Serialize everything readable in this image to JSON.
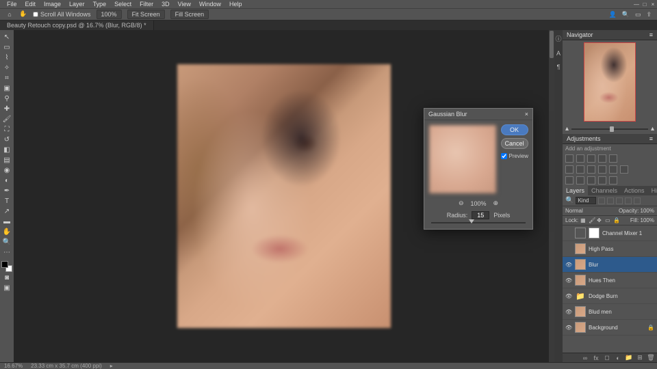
{
  "menu": [
    "File",
    "Edit",
    "Image",
    "Layer",
    "Type",
    "Select",
    "Filter",
    "3D",
    "View",
    "Window",
    "Help"
  ],
  "win": {
    "min": "—",
    "max": "□",
    "close": "×"
  },
  "options": {
    "scroll_all": "Scroll All Windows",
    "zoom_100": "100%",
    "fit_screen": "Fit Screen",
    "fill_screen": "Fill Screen"
  },
  "doc_tab": "Beauty Retouch copy.psd @ 16.7% (Blur, RGB/8) *",
  "status": {
    "zoom": "16.67%",
    "dim": "23.33 cm x 35.7 cm (400 ppi)"
  },
  "dialog": {
    "title": "Gaussian Blur",
    "ok": "OK",
    "cancel": "Cancel",
    "preview": "Preview",
    "zoom_out": "⊖",
    "zoom_pct": "100%",
    "zoom_in": "⊕",
    "radius_label": "Radius:",
    "radius_value": "15",
    "radius_unit": "Pixels"
  },
  "navigator": {
    "title": "Navigator"
  },
  "adjustments": {
    "title": "Adjustments",
    "hint": "Add an adjustment"
  },
  "layers": {
    "tabs": [
      "Layers",
      "Channels",
      "Actions",
      "History"
    ],
    "filter_kind": "Kind",
    "blend": "Normal",
    "opacity_label": "Opacity:",
    "opacity": "100%",
    "lock_label": "Lock:",
    "fill_label": "Fill:",
    "fill": "100%",
    "items": [
      {
        "visible": false,
        "name": "Channel Mixer 1",
        "type": "adj"
      },
      {
        "visible": false,
        "name": "High Pass",
        "type": "img"
      },
      {
        "visible": true,
        "name": "Blur",
        "type": "img",
        "selected": true
      },
      {
        "visible": true,
        "name": "Hues Then",
        "type": "img"
      },
      {
        "visible": true,
        "name": "Dodge Burn",
        "type": "folder"
      },
      {
        "visible": true,
        "name": "Blud men",
        "type": "img"
      },
      {
        "visible": true,
        "name": "Background",
        "type": "img",
        "locked": true
      }
    ]
  }
}
